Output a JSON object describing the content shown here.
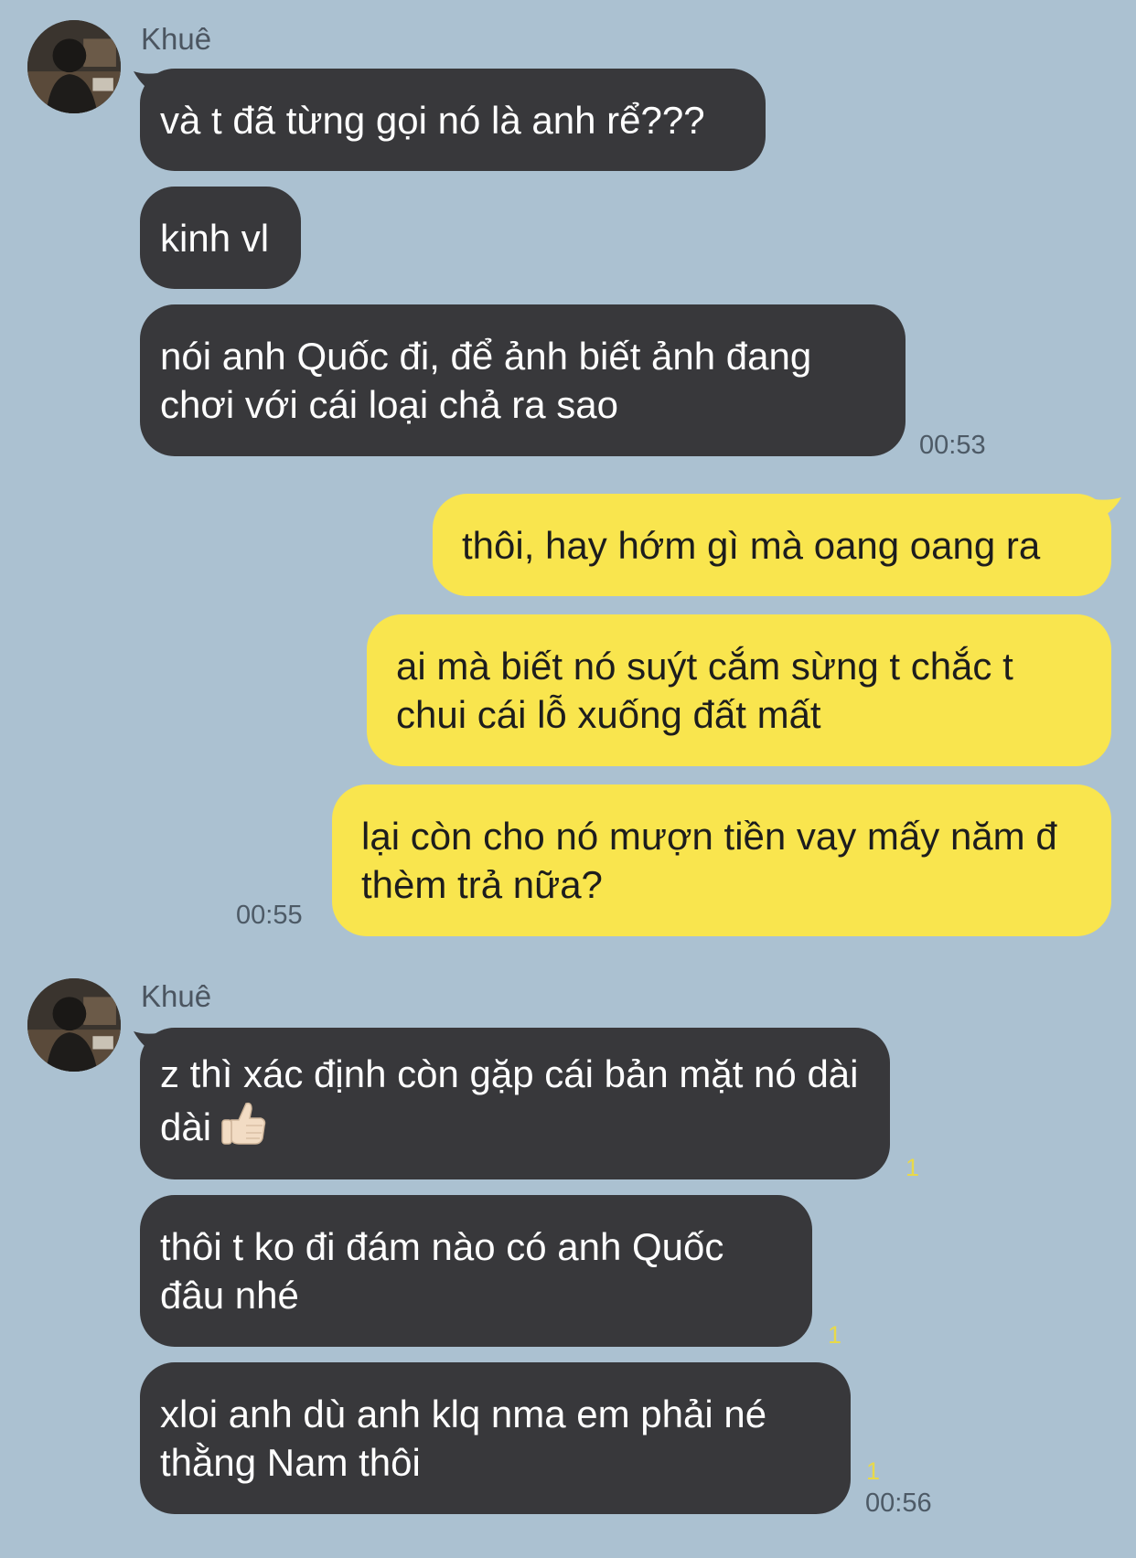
{
  "contact": {
    "name": "Khuê"
  },
  "messages": [
    {
      "text": "và t đã từng gọi nó là anh rể???"
    },
    {
      "text": "kinh vl"
    },
    {
      "text": "nói anh Quốc đi, để ảnh biết ảnh đang chơi với cái loại chả ra sao",
      "time": "00:53"
    },
    {
      "text": "thôi, hay hớm gì mà oang oang ra"
    },
    {
      "text": "ai mà biết nó suýt cắm sừng t chắc t chui cái lỗ xuống đất mất"
    },
    {
      "text": "lại còn cho nó mượn tiền vay mấy năm đ thèm trả nữa?",
      "time": "00:55"
    },
    {
      "text": "z thì xác định còn gặp cái bản mặt nó dài dài",
      "emoji": "thumbs-up",
      "read": "1"
    },
    {
      "text": "thôi t ko đi đám nào có anh Quốc đâu nhé",
      "read": "1"
    },
    {
      "text": "xloi anh dù anh klq nma em phải né thằng Nam thôi",
      "read": "1",
      "time": "00:56"
    }
  ],
  "colors": {
    "background": "#abc1d1",
    "incoming_bubble": "#38383b",
    "outgoing_bubble": "#f9e54e",
    "read_count": "#e8d94a"
  }
}
